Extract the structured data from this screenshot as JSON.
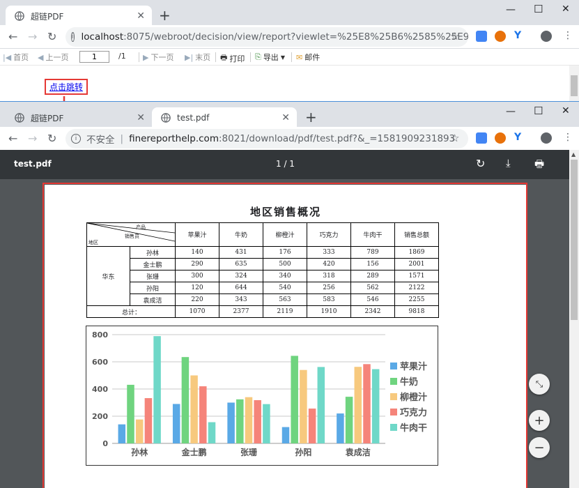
{
  "window1": {
    "tab_title": "超链PDF",
    "address": {
      "host": "localhost",
      "rest": ":8075/webroot/decision/view/report?viewlet=%25E8%25B6%2585%25E9%2..."
    }
  },
  "report_toolbar": {
    "first": "首页",
    "prev": "上一页",
    "page_value": "1",
    "page_total": "/1",
    "next": "下一页",
    "last": "末页",
    "print": "打印",
    "export": "导出",
    "email": "邮件"
  },
  "link_text": "点击跳转",
  "window2": {
    "tab1_title": "超链PDF",
    "tab2_title": "test.pdf",
    "insecure_label": "不安全",
    "address": {
      "host": "finereporthelp.com",
      "rest": ":8021/download/pdf/test.pdf?&_=1581909231893"
    }
  },
  "pdf_viewer": {
    "file_name": "test.pdf",
    "page_indicator": "1 / 1"
  },
  "report": {
    "title": "地区销售概况",
    "header_product": "产品",
    "header_salesperson": "销售员",
    "header_region": "地区",
    "columns": [
      "苹果汁",
      "牛奶",
      "柳橙汁",
      "巧克力",
      "牛肉干",
      "销售总额"
    ],
    "region": "华东",
    "rows": [
      {
        "name": "孙林",
        "values": [
          "140",
          "431",
          "176",
          "333",
          "789",
          "1869"
        ]
      },
      {
        "name": "金士鹏",
        "values": [
          "290",
          "635",
          "500",
          "420",
          "156",
          "2001"
        ]
      },
      {
        "name": "张珊",
        "values": [
          "300",
          "324",
          "340",
          "318",
          "289",
          "1571"
        ]
      },
      {
        "name": "孙阳",
        "values": [
          "120",
          "644",
          "540",
          "256",
          "562",
          "2122"
        ]
      },
      {
        "name": "袁成洁",
        "values": [
          "220",
          "343",
          "563",
          "583",
          "546",
          "2255"
        ]
      }
    ],
    "total_label": "总计：",
    "totals": [
      "1070",
      "2377",
      "2119",
      "1910",
      "2342",
      "9818"
    ]
  },
  "colors": {
    "苹果汁": "#5aa9e6",
    "牛奶": "#6fd47f",
    "柳橙汁": "#f7c97e",
    "巧克力": "#f5847a",
    "牛肉干": "#6fd8c8",
    "highlight_red": "#e53935"
  },
  "chart_data": {
    "type": "bar",
    "categories": [
      "孙林",
      "金士鹏",
      "张珊",
      "孙阳",
      "袁成洁"
    ],
    "series": [
      {
        "name": "苹果汁",
        "values": [
          140,
          290,
          300,
          120,
          220
        ]
      },
      {
        "name": "牛奶",
        "values": [
          431,
          635,
          324,
          644,
          343
        ]
      },
      {
        "name": "柳橙汁",
        "values": [
          176,
          500,
          340,
          540,
          563
        ]
      },
      {
        "name": "巧克力",
        "values": [
          333,
          420,
          318,
          256,
          583
        ]
      },
      {
        "name": "牛肉干",
        "values": [
          789,
          156,
          289,
          562,
          546
        ]
      }
    ],
    "yticks": [
      0,
      200,
      400,
      600,
      800
    ],
    "ylim": [
      0,
      800
    ],
    "grid": true,
    "legend_position": "right"
  }
}
